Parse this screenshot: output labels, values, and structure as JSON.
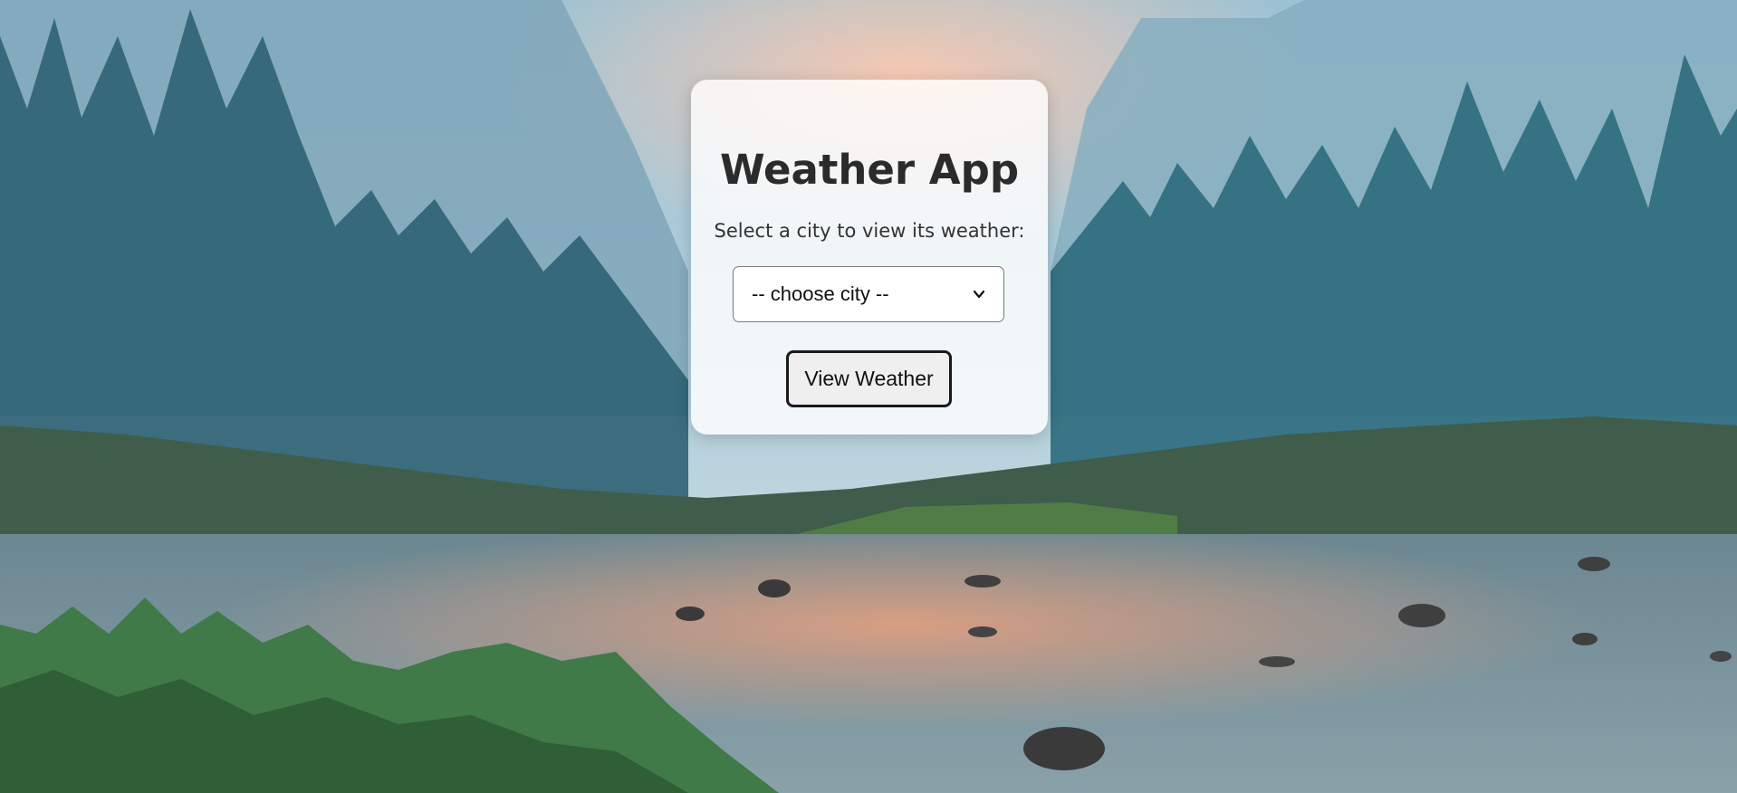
{
  "app": {
    "title": "Weather App",
    "subtitle": "Select a city to view its weather:"
  },
  "city_select": {
    "selected": "-- choose city --",
    "icon": "chevron-down-icon"
  },
  "view_button": {
    "label": "View Weather"
  },
  "colors": {
    "card_background": "#ffffff",
    "title_text": "#2b2b2b",
    "button_background": "#efefef",
    "button_border": "#1a1a1a"
  }
}
